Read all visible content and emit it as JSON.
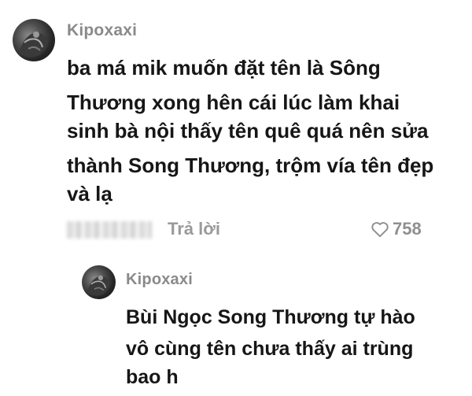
{
  "comment": {
    "username": "Kipoxaxi",
    "text_lines": [
      "ba má mik muốn đặt tên là Sông",
      "Thương xong hên cái lúc làm khai",
      "sinh bà nội thấy tên quê quá nên sửa",
      "thành Song Thương, trộm vía tên đẹp",
      "và lạ"
    ],
    "reply_label": "Trả lời",
    "like_count": "758",
    "icons": {
      "avatar": "avatar-image",
      "like": "heart-outline-icon"
    }
  },
  "reply": {
    "username": "Kipoxaxi",
    "text_lines": [
      "Bùi Ngọc Song Thương tự hào",
      "vô cùng tên chưa thấy ai trùng",
      "bao h"
    ]
  },
  "colors": {
    "username": "#8a8a8a",
    "text": "#161616",
    "secondary": "#9a9a9a"
  }
}
